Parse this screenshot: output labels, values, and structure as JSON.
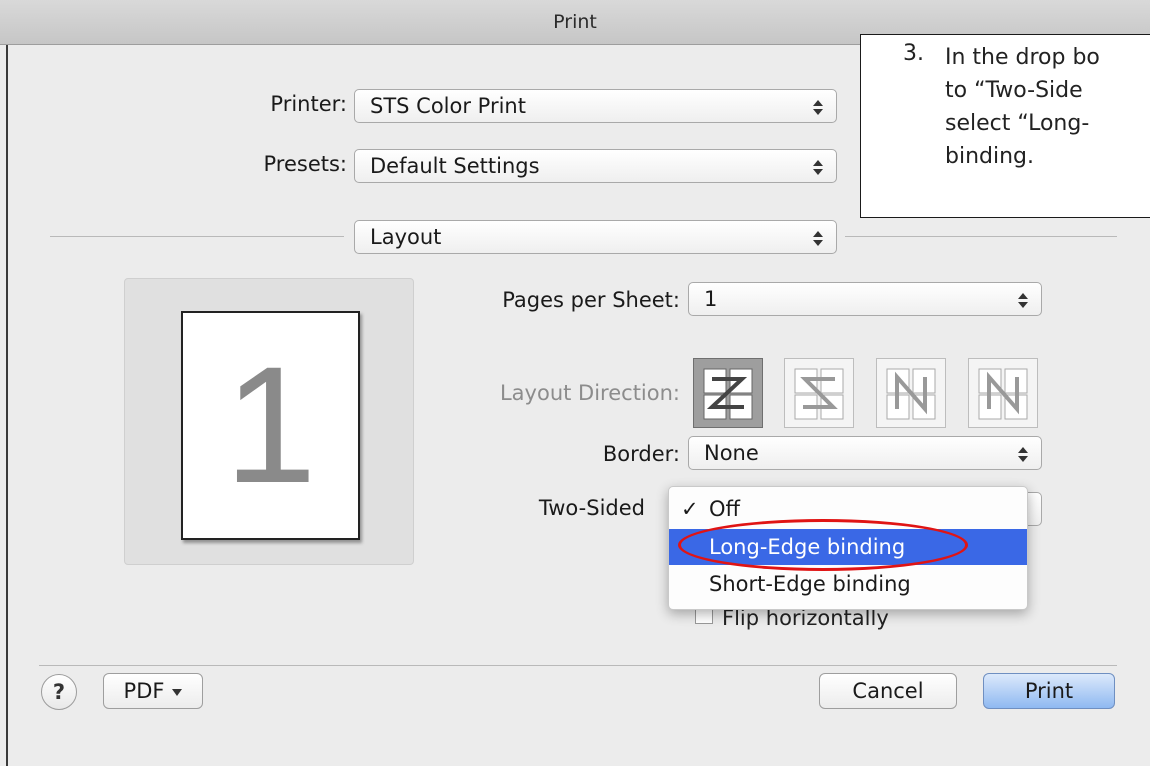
{
  "window": {
    "title": "Print"
  },
  "printer": {
    "label": "Printer:",
    "value": "STS Color Print"
  },
  "presets": {
    "label": "Presets:",
    "value": "Default Settings"
  },
  "panel": {
    "value": "Layout"
  },
  "preview": {
    "page_number": "1"
  },
  "pages_per_sheet": {
    "label": "Pages per Sheet:",
    "value": "1"
  },
  "layout_direction": {
    "label": "Layout Direction:",
    "options": [
      "z-direction-icon",
      "s-direction-icon",
      "n-reverse-direction-icon",
      "n-direction-icon"
    ],
    "selected_index": 0
  },
  "border": {
    "label": "Border:",
    "value": "None"
  },
  "two_sided": {
    "label": "Two-Sided",
    "menu": [
      {
        "label": "Off",
        "checked": true
      },
      {
        "label": "Long-Edge binding",
        "highlighted": true
      },
      {
        "label": "Short-Edge binding"
      }
    ]
  },
  "flip": {
    "label": "Flip horizontally",
    "checked": false
  },
  "annotation": {
    "color": "#e01414"
  },
  "callout": {
    "number": "3.",
    "text": "In the drop bo\nto “Two-Side\nselect “Long-\nbinding."
  },
  "footer": {
    "help": "?",
    "pdf": "PDF",
    "cancel": "Cancel",
    "print": "Print"
  },
  "colors": {
    "highlight": "#3a68e6",
    "primary_button": "#8fb9f1"
  }
}
